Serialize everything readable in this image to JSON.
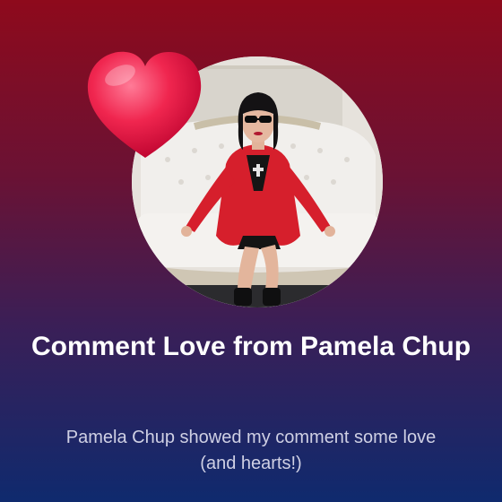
{
  "card": {
    "title": "Comment Love from Pamela Chup",
    "subtitle": "Pamela Chup showed my comment some love (and hearts!)"
  },
  "colors": {
    "background_top": "#8e0a1c",
    "background_bottom": "#0f2a6e",
    "heart": "#f0264f",
    "jacket": "#d61f2c"
  },
  "icons": {
    "heart": "heart-icon",
    "avatar": "profile-photo"
  }
}
